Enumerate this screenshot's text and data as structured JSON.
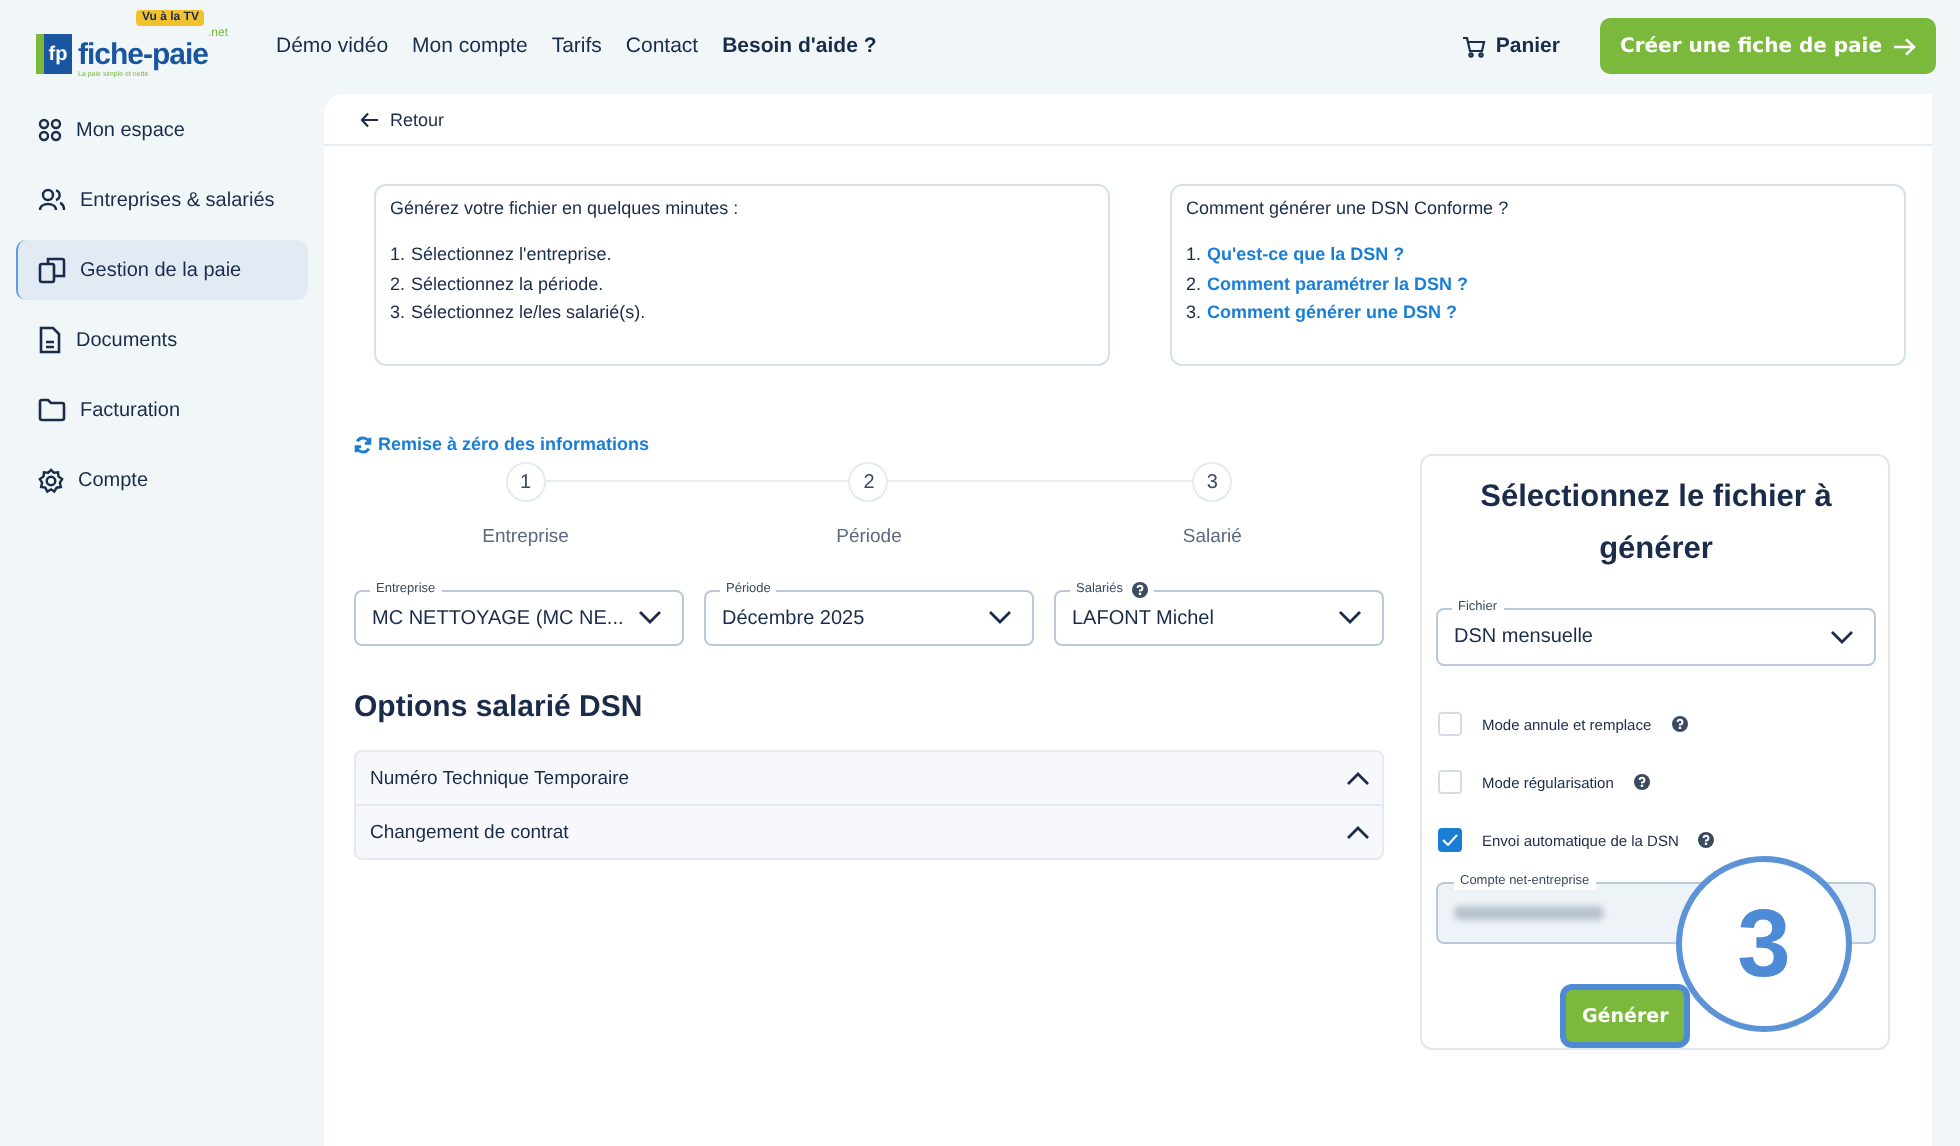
{
  "header": {
    "logo": {
      "mark": "fp",
      "name": "fiche-paie",
      "suffix": ".net",
      "badge": "Vu à la TV",
      "tagline": "La paie simple et nette"
    },
    "nav": [
      {
        "label": "Démo vidéo",
        "bold": false
      },
      {
        "label": "Mon compte",
        "bold": false
      },
      {
        "label": "Tarifs",
        "bold": false
      },
      {
        "label": "Contact",
        "bold": false
      },
      {
        "label": "Besoin d'aide ?",
        "bold": true
      }
    ],
    "cart": "Panier",
    "cta": "Créer une fiche de paie"
  },
  "sidebar": {
    "items": [
      {
        "label": "Mon espace",
        "selected": false
      },
      {
        "label": "Entreprises & salariés",
        "selected": false
      },
      {
        "label": "Gestion de la paie",
        "selected": true
      },
      {
        "label": "Documents",
        "selected": false
      },
      {
        "label": "Facturation",
        "selected": false
      },
      {
        "label": "Compte",
        "selected": false
      }
    ]
  },
  "back": "Retour",
  "info_cards": [
    {
      "title": "Générez votre fichier en quelques minutes :",
      "items": [
        {
          "number": "1.",
          "text": "Sélectionnez l'entreprise.",
          "kind": "text"
        },
        {
          "number": "2.",
          "text": "Sélectionnez la période.",
          "kind": "text"
        },
        {
          "number": "3.",
          "text": "Sélectionnez le/les salarié(s).",
          "kind": "text"
        }
      ]
    },
    {
      "title": "Comment générer une DSN Conforme ?",
      "items": [
        {
          "number": "1.",
          "text": "Qu'est-ce que la DSN ?",
          "kind": "link"
        },
        {
          "number": "2.",
          "text": "Comment paramétrer la DSN ?",
          "kind": "link"
        },
        {
          "number": "3.",
          "text": "Comment générer une DSN ?",
          "kind": "link"
        }
      ]
    }
  ],
  "reset_link": "Remise à zéro des informations",
  "steps": [
    {
      "number": "1",
      "label": "Entreprise"
    },
    {
      "number": "2",
      "label": "Période"
    },
    {
      "number": "3",
      "label": "Salarié"
    }
  ],
  "selects": [
    {
      "label": "Entreprise",
      "value": "MC NETTOYAGE (MC NE...",
      "help": false
    },
    {
      "label": "Période",
      "value": "Décembre 2025",
      "help": false
    },
    {
      "label": "Salariés",
      "value": "LAFONT Michel",
      "help": true
    }
  ],
  "options_title": "Options salarié DSN",
  "accordion": [
    {
      "label": "Numéro Technique Temporaire",
      "expanded": false
    },
    {
      "label": "Changement de contrat",
      "expanded": false
    }
  ],
  "file_panel": {
    "title": "Sélectionnez le fichier à générer",
    "select": {
      "label": "Fichier",
      "value": "DSN mensuelle"
    },
    "checkboxes": [
      {
        "label": "Mode annule et remplace",
        "checked": false
      },
      {
        "label": "Mode régularisation",
        "checked": false
      },
      {
        "label": "Envoi automatique de la DSN",
        "checked": true
      }
    ],
    "account_field": {
      "label": "Compte net-entreprise",
      "blurred": true
    },
    "button": "Générer"
  },
  "callout": {
    "number": "3"
  }
}
